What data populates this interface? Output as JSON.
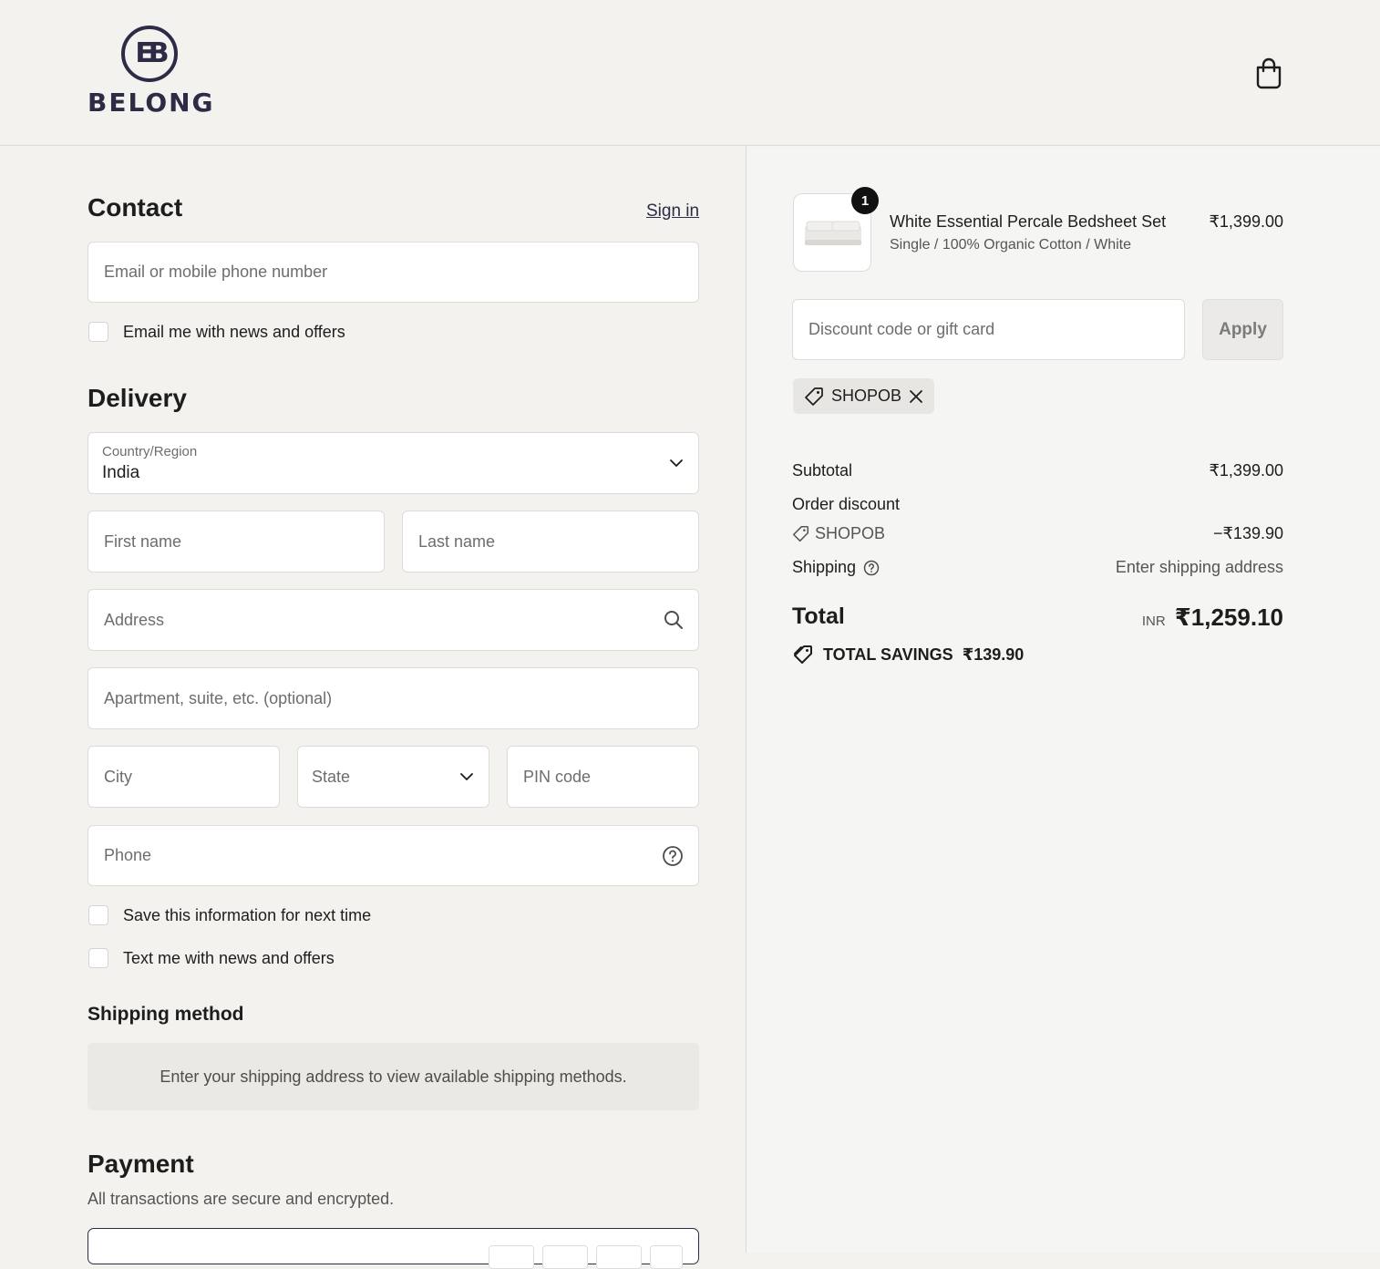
{
  "brand": {
    "mark": "EB",
    "name": "BELONG"
  },
  "contact": {
    "heading": "Contact",
    "sign_in": "Sign in",
    "email_placeholder": "Email or mobile phone number",
    "news_label": "Email me with news and offers"
  },
  "delivery": {
    "heading": "Delivery",
    "country_label": "Country/Region",
    "country_value": "India",
    "first_name_placeholder": "First name",
    "last_name_placeholder": "Last name",
    "address_placeholder": "Address",
    "apartment_placeholder": "Apartment, suite, etc. (optional)",
    "city_placeholder": "City",
    "state_label": "State",
    "pin_placeholder": "PIN code",
    "phone_placeholder": "Phone",
    "save_info_label": "Save this information for next time",
    "text_news_label": "Text me with news and offers"
  },
  "shipping_method": {
    "heading": "Shipping method",
    "message": "Enter your shipping address to view available shipping methods."
  },
  "payment": {
    "heading": "Payment",
    "subtitle": "All transactions are secure and encrypted."
  },
  "summary": {
    "item": {
      "quantity": "1",
      "title": "White Essential Percale Bedsheet Set",
      "variant": "Single / 100% Organic Cotton / White",
      "price": "₹1,399.00"
    },
    "discount_placeholder": "Discount code or gift card",
    "apply_label": "Apply",
    "applied_code": "SHOPOB",
    "subtotal_label": "Subtotal",
    "subtotal_value": "₹1,399.00",
    "order_discount_label": "Order discount",
    "discount_code": "SHOPOB",
    "discount_value": "−₹139.90",
    "shipping_label": "Shipping",
    "shipping_value": "Enter shipping address",
    "total_label": "Total",
    "currency": "INR",
    "total_value": "₹1,259.10",
    "savings_label": "TOTAL SAVINGS",
    "savings_value": "₹139.90"
  },
  "icons": {
    "cart": "shopping-bag-icon",
    "chevron": "chevron-down-icon",
    "search": "search-icon",
    "help": "question-circle-icon",
    "tag": "tag-icon",
    "close": "close-icon"
  },
  "colors": {
    "brand": "#2d2b45",
    "background": "#f3f2ef",
    "badge": "#111111"
  }
}
